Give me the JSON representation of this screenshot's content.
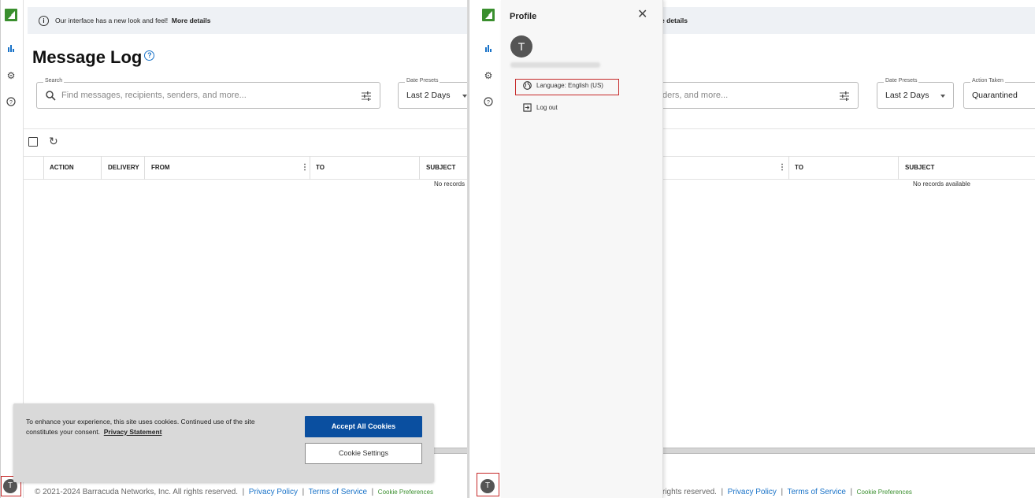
{
  "banner": {
    "message": "Our interface has a new look and feel!",
    "link": "More details",
    "link_partial": "e details"
  },
  "page": {
    "title": "Message Log"
  },
  "search": {
    "label": "Search",
    "placeholder": "Find messages, recipients, senders, and more...",
    "placeholder_partial": "ders, and more..."
  },
  "filters": {
    "date_presets_label": "Date Presets",
    "date_presets_value": "Last 2 Days",
    "action_taken_label": "Action Taken",
    "action_taken_value": "Quarantined"
  },
  "table": {
    "columns": [
      "ACTION",
      "DELIVERY",
      "FROM",
      "TO",
      "SUBJECT"
    ],
    "empty_text": "No records available",
    "empty_text_partial": "No records"
  },
  "cookie_banner": {
    "message": "To enhance your experience, this site uses cookies. Continued use of the site constitutes your consent.",
    "privacy_link": "Privacy Statement",
    "accept_label": "Accept All Cookies",
    "settings_label": "Cookie Settings"
  },
  "footer": {
    "copyright": "© 2021-2024 Barracuda Networks, Inc. All rights reserved.",
    "copyright_partial": "rights reserved.",
    "privacy": "Privacy Policy",
    "terms": "Terms of Service",
    "cookie_prefs": "Cookie Preferences",
    "sep": "|"
  },
  "profile": {
    "title": "Profile",
    "avatar_letter": "T",
    "language_label": "Language: English (US)",
    "logout_label": "Log out"
  },
  "user": {
    "avatar_letter": "T"
  },
  "colors": {
    "brand_green": "#3a8f2e",
    "accent_blue": "#0a4fa0",
    "link_blue": "#1a73c8",
    "highlight_red": "#c62828"
  }
}
